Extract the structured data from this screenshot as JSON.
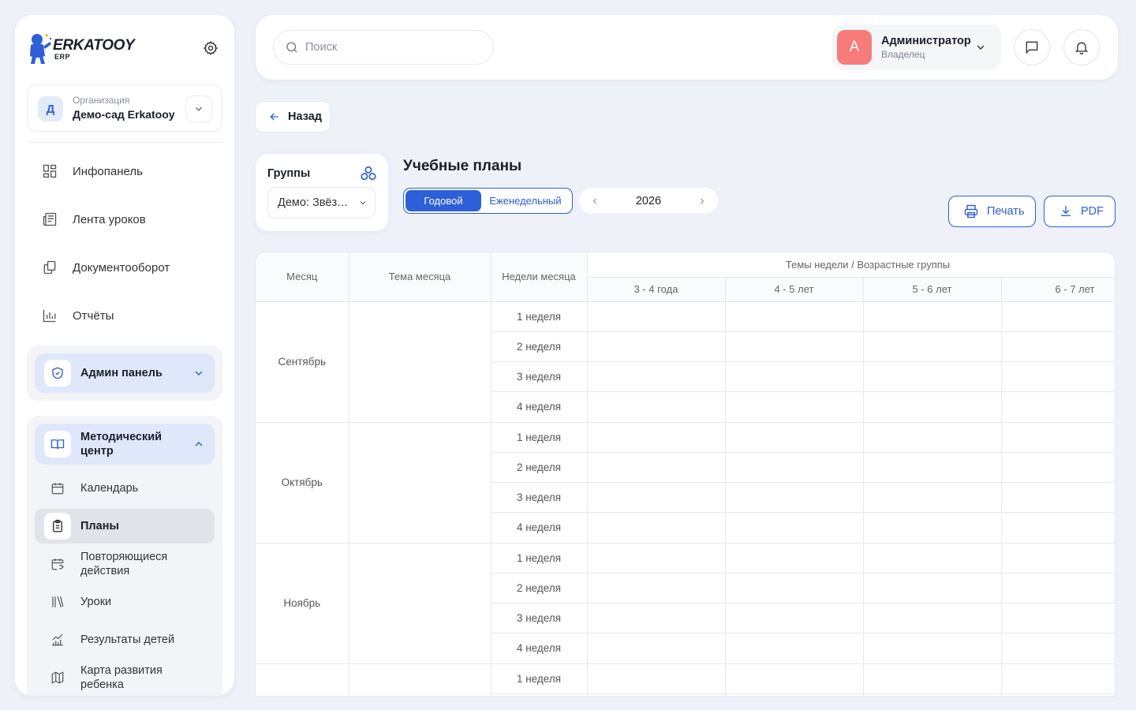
{
  "brand": {
    "name": "ERKATOOY",
    "sub": "ERP"
  },
  "org": {
    "avatar_letter": "Д",
    "label": "Организация",
    "name": "Демо-сад Erkatooy"
  },
  "sidebar": {
    "items": [
      {
        "label": "Инфопанель",
        "icon": "dashboard-icon"
      },
      {
        "label": "Лента уроков",
        "icon": "newspaper-icon"
      },
      {
        "label": "Документооборот",
        "icon": "documents-icon"
      },
      {
        "label": "Отчёты",
        "icon": "chart-icon"
      }
    ],
    "admin_group": {
      "label": "Админ панель",
      "icon": "shield-icon"
    },
    "method_group": {
      "label": "Методический центр",
      "icon": "book-icon",
      "items": [
        {
          "label": "Календарь",
          "icon": "calendar-icon"
        },
        {
          "label": "Планы",
          "icon": "clipboard-icon",
          "active": true
        },
        {
          "label": "Повторяющиеся действия",
          "icon": "repeat-calendar-icon"
        },
        {
          "label": "Уроки",
          "icon": "books-icon"
        },
        {
          "label": "Результаты детей",
          "icon": "growth-chart-icon"
        },
        {
          "label": "Карта развития ребенка",
          "icon": "map-icon"
        }
      ]
    }
  },
  "header": {
    "search_placeholder": "Поиск",
    "user": {
      "avatar_letter": "А",
      "name": "Администратор",
      "role": "Владелец"
    }
  },
  "content": {
    "back_label": "Назад",
    "groups": {
      "title": "Группы",
      "selected": "Демо: Звёздочки"
    },
    "title": "Учебные планы",
    "view_modes": {
      "active": "Годовой",
      "inactive": "Еженедельный"
    },
    "year": "2026",
    "print_label": "Печать",
    "pdf_label": "PDF"
  },
  "table": {
    "headers": {
      "month": "Месяц",
      "theme": "Тема месяца",
      "weeks": "Недели месяца",
      "group_themes": "Темы недели / Возрастные группы"
    },
    "age_groups": [
      "3 - 4 года",
      "4 - 5 лет",
      "5 - 6 лет",
      "6 - 7 лет"
    ],
    "months": [
      {
        "name": "Сентябрь",
        "weeks": [
          "1 неделя",
          "2 неделя",
          "3 неделя",
          "4 неделя"
        ]
      },
      {
        "name": "Октябрь",
        "weeks": [
          "1 неделя",
          "2 неделя",
          "3 неделя",
          "4 неделя"
        ]
      },
      {
        "name": "Ноябрь",
        "weeks": [
          "1 неделя",
          "2 неделя",
          "3 неделя",
          "4 неделя"
        ]
      },
      {
        "name": "",
        "weeks": [
          "1 неделя",
          ""
        ]
      }
    ]
  },
  "colors": {
    "accent": "#2d5fd8",
    "avatar_user": "#f77b7b",
    "bg": "#eef1f8"
  }
}
